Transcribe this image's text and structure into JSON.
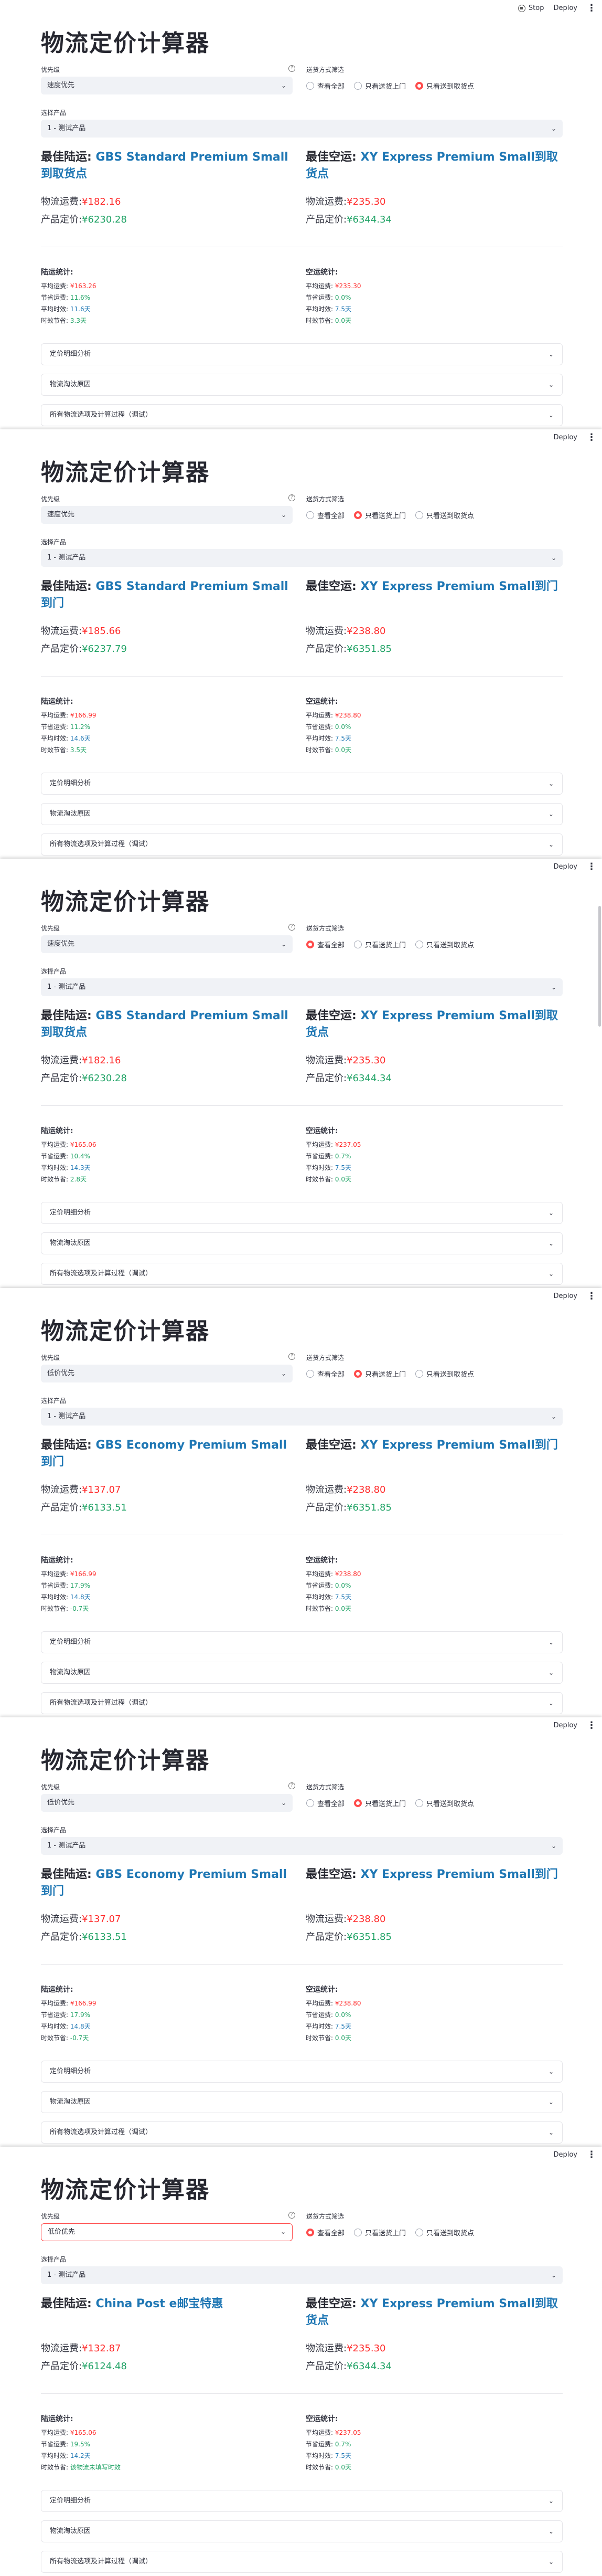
{
  "app": {
    "title": "物流定价计算器",
    "stop_label": "Stop",
    "deploy_label": "Deploy",
    "priority_label": "优先级",
    "filter_label": "送货方式筛选",
    "product_label": "选择产品",
    "filter_options": [
      "查看全部",
      "只看送货上门",
      "只看送到取货点"
    ],
    "best_land_label": "最佳陆运:",
    "best_air_label": "最佳空运:",
    "shipping_cost_label": "物流运费:",
    "product_price_label": "产品定价:",
    "land_stats_title": "陆运统计:",
    "air_stats_title": "空运统计:",
    "avg_cost_label": "平均运费:",
    "saving_ratio_label": "节省运费:",
    "avg_time_label": "平均时效:",
    "time_saving_label": "时效节省:",
    "expanders": [
      "定价明细分析",
      "物流淘汰原因",
      "所有物流选项及计算过程（调试）"
    ]
  },
  "panels": [
    {
      "show_stop": true,
      "priority": "速度优先",
      "filter_selected": 2,
      "product": "1 - 测试产品",
      "best_land": "GBS Standard Premium Small到取货点",
      "best_air": "XY Express Premium Small到取货点",
      "land_cost": "¥182.16",
      "land_price": "¥6230.28",
      "air_cost": "¥235.30",
      "air_price": "¥6344.34",
      "land_stats": {
        "avg": "¥163.26",
        "save": "11.6%",
        "time": "11.6天",
        "time_save": "3.3天"
      },
      "air_stats": {
        "avg": "¥235.30",
        "save": "0.0%",
        "time": "7.5天",
        "time_save": "0.0天"
      }
    },
    {
      "show_stop": false,
      "priority": "速度优先",
      "filter_selected": 1,
      "product": "1 - 测试产品",
      "best_land": "GBS Standard Premium Small到门",
      "best_air": "XY Express Premium Small到门",
      "land_cost": "¥185.66",
      "land_price": "¥6237.79",
      "air_cost": "¥238.80",
      "air_price": "¥6351.85",
      "land_stats": {
        "avg": "¥166.99",
        "save": "11.2%",
        "time": "14.6天",
        "time_save": "3.5天"
      },
      "air_stats": {
        "avg": "¥238.80",
        "save": "0.0%",
        "time": "7.5天",
        "time_save": "0.0天"
      }
    },
    {
      "show_stop": false,
      "priority": "速度优先",
      "filter_selected": 0,
      "product": "1 - 测试产品",
      "best_land": "GBS Standard Premium Small到取货点",
      "best_air": "XY Express Premium Small到取货点",
      "land_cost": "¥182.16",
      "land_price": "¥6230.28",
      "air_cost": "¥235.30",
      "air_price": "¥6344.34",
      "land_stats": {
        "avg": "¥165.06",
        "save": "10.4%",
        "time": "14.3天",
        "time_save": "2.8天"
      },
      "air_stats": {
        "avg": "¥237.05",
        "save": "0.7%",
        "time": "7.5天",
        "time_save": "0.0天"
      }
    },
    {
      "show_stop": false,
      "priority": "低价优先",
      "filter_selected": 1,
      "product": "1 - 测试产品",
      "best_land": "GBS Economy Premium Small到门",
      "best_air": "XY Express Premium Small到门",
      "land_cost": "¥137.07",
      "land_price": "¥6133.51",
      "air_cost": "¥238.80",
      "air_price": "¥6351.85",
      "land_stats": {
        "avg": "¥166.99",
        "save": "17.9%",
        "time": "14.8天",
        "time_save": "-0.7天"
      },
      "air_stats": {
        "avg": "¥238.80",
        "save": "0.0%",
        "time": "7.5天",
        "time_save": "0.0天"
      }
    },
    {
      "show_stop": false,
      "priority": "低价优先",
      "filter_selected": 1,
      "product": "1 - 测试产品",
      "best_land": "GBS Economy Premium Small到门",
      "best_air": "XY Express Premium Small到门",
      "land_cost": "¥137.07",
      "land_price": "¥6133.51",
      "air_cost": "¥238.80",
      "air_price": "¥6351.85",
      "land_stats": {
        "avg": "¥166.99",
        "save": "17.9%",
        "time": "14.8天",
        "time_save": "-0.7天"
      },
      "air_stats": {
        "avg": "¥238.80",
        "save": "0.0%",
        "time": "7.5天",
        "time_save": "0.0天"
      }
    },
    {
      "show_stop": false,
      "priority": "低价优先",
      "filter_selected": 0,
      "product": "1 - 测试产品",
      "best_land": "China Post e邮宝特惠",
      "best_air": "XY Express Premium Small到取货点",
      "land_cost": "¥132.87",
      "land_price": "¥6124.48",
      "air_cost": "¥235.30",
      "air_price": "¥6344.34",
      "land_stats": {
        "avg": "¥165.06",
        "save": "19.5%",
        "time": "14.2天",
        "time_save": "该物流未填写时效"
      },
      "air_stats": {
        "avg": "¥237.05",
        "save": "0.7%",
        "time": "7.5天",
        "time_save": "0.0天"
      }
    }
  ]
}
